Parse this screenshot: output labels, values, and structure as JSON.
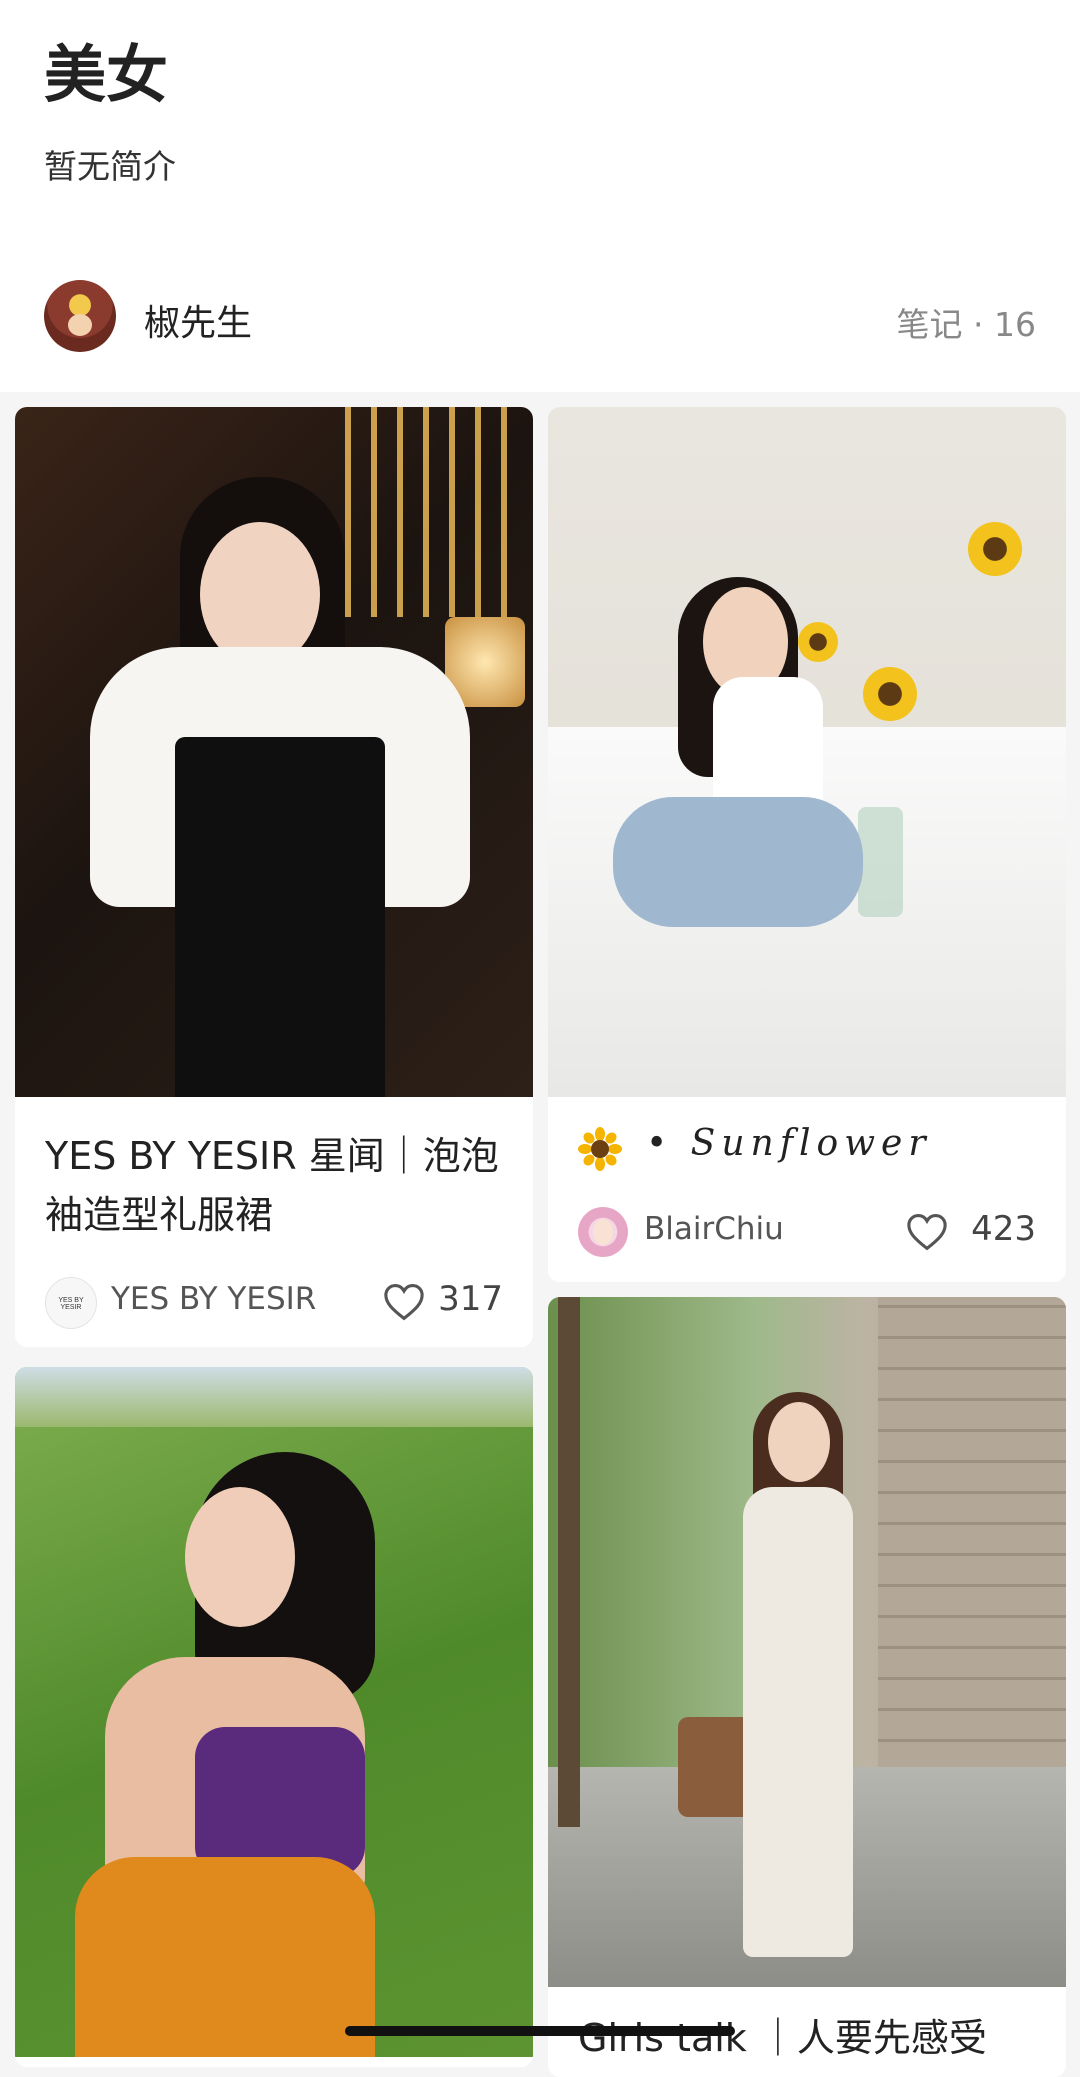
{
  "collection": {
    "title": "美女",
    "intro": "暂无简介",
    "author_name": "椒先生",
    "notes_count": "笔记 · 16"
  },
  "feed": [
    {
      "title": "YES BY YESIR 星闻｜泡泡袖造型礼服裙",
      "author": "YES BY YESIR",
      "author_avatar_text": "YES BY YESIR",
      "likes": "317",
      "image": "photo"
    },
    {
      "title": "🌻 • Sunflower",
      "title_icon": "sunflower-icon",
      "title_text": "• Sunflower",
      "author": "BlairChiu",
      "likes": "423",
      "image": "photo"
    },
    {
      "title": "",
      "image": "photo"
    },
    {
      "title": "Girls talk ｜人要先感受",
      "image": "photo"
    }
  ],
  "colors": {
    "background": "#f5f5f5",
    "card": "#ffffff",
    "text_primary": "#222222",
    "text_secondary": "#888888"
  }
}
